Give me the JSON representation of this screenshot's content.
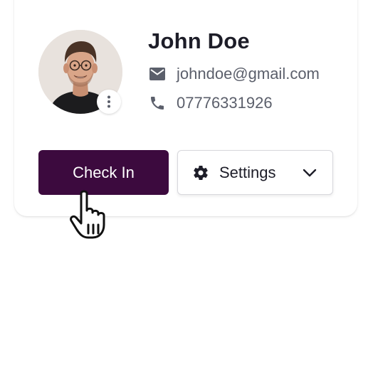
{
  "profile": {
    "name": "John Doe",
    "email": "johndoe@gmail.com",
    "phone": "07776331926"
  },
  "icons": {
    "avatar_more": "more-vertical-icon",
    "email": "mail-icon",
    "phone": "phone-icon",
    "settings": "gear-icon",
    "settings_caret": "chevron-down-icon",
    "cursor": "hand-pointer-icon"
  },
  "actions": {
    "check_in_label": "Check In",
    "settings_label": "Settings"
  },
  "colors": {
    "primary": "#3c0a3e",
    "name_text": "#1d1d28",
    "muted_text": "#5b5f6b",
    "icon_gray": "#5b5f6b"
  }
}
